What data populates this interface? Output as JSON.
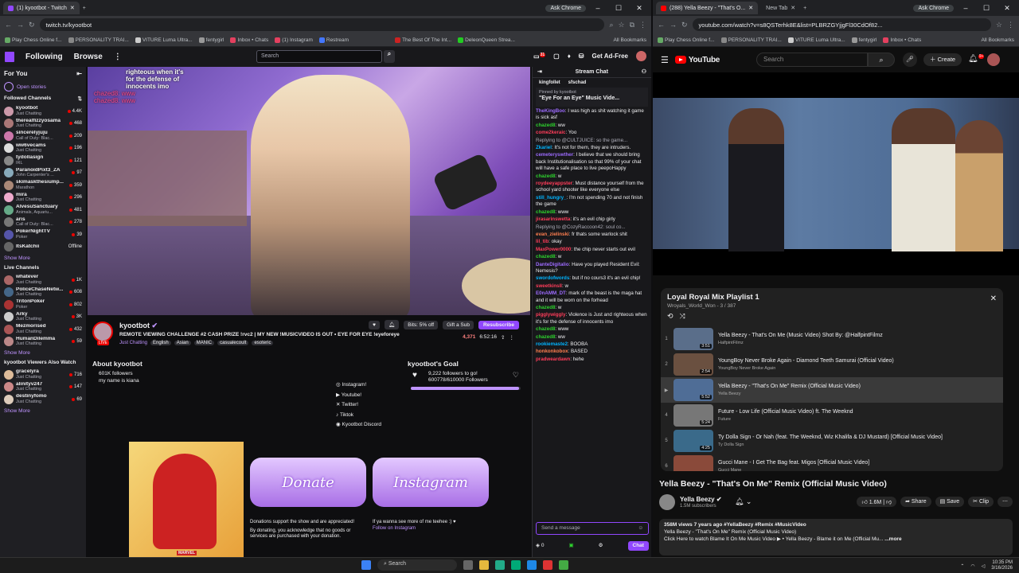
{
  "twitch_browser": {
    "tabs": [
      {
        "label": "(1) kyootbot - Twitch",
        "active": true
      },
      {
        "label": "New Tab",
        "active": false
      }
    ],
    "ask_chrome": "Ask Chrome",
    "url": "twitch.tv/kyootbot",
    "bookmarks": [
      "Play Chess Online f...",
      "PERSONALITY TRAI...",
      "VITURE Luma Ultra...",
      "fentygirl",
      "Inbox • Chats",
      "(1) Instagram",
      "Restream",
      "The Best Of The Int...",
      "DeleonQueen Strea...",
      "All Bookmarks"
    ]
  },
  "twitch": {
    "nav": {
      "following": "Following",
      "browse": "Browse",
      "search_placeholder": "Search",
      "ad_free": "Get Ad-Free",
      "notif_count": "31"
    },
    "sidebar": {
      "for_you": "For You",
      "open_stories": "Open stories",
      "followed_title": "Followed Channels",
      "followed": [
        {
          "name": "kyootbot",
          "game": "Just Chatting",
          "viewers": "4.4K",
          "color": "#c9a"
        },
        {
          "name": "therealfizzyosama",
          "game": "Just Chatting",
          "viewers": "468",
          "color": "#a77"
        },
        {
          "name": "sincerelyjuju",
          "game": "Call of Duty: Blac...",
          "viewers": "209",
          "color": "#c7a"
        },
        {
          "name": "ww6vecams",
          "game": "Just Chatting",
          "viewers": "196",
          "color": "#ddd"
        },
        {
          "name": "tydollasign",
          "game": "IRL",
          "viewers": "121",
          "color": "#888"
        },
        {
          "name": "ParanoidPixt3_ZA",
          "game": "John Carpenter's ...",
          "viewers": "97",
          "color": "#8ab"
        },
        {
          "name": "skimaskthesiump...",
          "game": "Marathon",
          "viewers": "359",
          "color": "#a87"
        },
        {
          "name": "mira",
          "game": "Just Chatting",
          "viewers": "296",
          "color": "#eac"
        },
        {
          "name": "AlvesuSanctuary",
          "game": "Animals, Aquariu...",
          "viewers": "481",
          "color": "#6a8"
        },
        {
          "name": "aris",
          "game": "Call of Duty: Blac...",
          "viewers": "278",
          "color": "#777"
        },
        {
          "name": "PokerNightTV",
          "game": "Poker",
          "viewers": "39",
          "color": "#55a"
        },
        {
          "name": "ItsKatchii",
          "game": "",
          "viewers": "Offline",
          "color": "#666"
        }
      ],
      "show_more": "Show More",
      "live_title": "Live Channels",
      "live": [
        {
          "name": "whatever",
          "game": "Just Chatting",
          "viewers": "1K",
          "color": "#a66"
        },
        {
          "name": "PoliceChaseNetw...",
          "game": "Just Chatting",
          "viewers": "608",
          "color": "#468"
        },
        {
          "name": "TritonPoker",
          "game": "Poker",
          "viewers": "802",
          "color": "#a33"
        },
        {
          "name": "Arky",
          "game": "Just Chatting",
          "viewers": "3K",
          "color": "#ccc"
        },
        {
          "name": "Mezmorised",
          "game": "Just Chatting",
          "viewers": "432",
          "color": "#a55"
        },
        {
          "name": "HumanDilemma",
          "game": "Just Chatting",
          "viewers": "59",
          "color": "#b88"
        }
      ],
      "also_title": "kyootbot Viewers Also Watch",
      "also": [
        {
          "name": "gracelyra",
          "game": "Just Chatting",
          "viewers": "716",
          "color": "#db9"
        },
        {
          "name": "alinityv247",
          "game": "Just Chatting",
          "viewers": "147",
          "color": "#c88"
        },
        {
          "name": "destinyfomo",
          "game": "Just Chatting",
          "viewers": "69",
          "color": "#dcb"
        }
      ]
    },
    "overlay_chat": [
      "righteous when it's",
      "for the defense of",
      "innocents imo",
      "chazed8: www",
      "chazed8: www"
    ],
    "stream": {
      "name": "kyootbot",
      "title": "REMOTE VIEWING CHALLENGE #2 CASH PRIZE !rvc2 | MY NEW !MUSICVIDEO IS OUT • EYE FOR EYE !eyeforeye",
      "category": "Just Chatting",
      "tags": [
        "English",
        "Asian",
        "MANIC",
        "casualecoult",
        "esoteric"
      ],
      "bits": "Bits: 5% off",
      "gift_sub": "Gift a Sub",
      "resubscribe": "Resubscribe",
      "viewers": "4,371",
      "uptime": "6:52:16",
      "live": "LIVE"
    },
    "about": {
      "title": "About kyootbot",
      "followers": "601K followers",
      "bio": "my name is kiana",
      "socials": [
        "Instagram!",
        "Youtube!",
        "Twitter!",
        "Tiktok",
        "Kyootbot Discord"
      ]
    },
    "goal": {
      "title": "kyootbot's Goal",
      "line1": "9,222 followers to go!",
      "line2": "600778/610000 Followers",
      "progress": 0.985
    },
    "panels": {
      "donate": "Donate",
      "instagram": "Instagram",
      "donate_text": "Donations support the show and are appreciated!",
      "donate_note": "By donating, you acknowledge that no goods or services are purchased with your donation.",
      "insta_text": "If ya wanna see more of me teehee :) ♥",
      "insta_link": "Follow on Instagram",
      "marvel": "MARVEL"
    },
    "chat": {
      "header": "Stream Chat",
      "gifters": [
        "kingfollet",
        "sfschad"
      ],
      "pinned_by": "Pinned by kyootbot",
      "pinned": "\"Eye For an Eye\" Music Vide...",
      "messages": [
        {
          "user": "TheKingBoo",
          "text": "I was high as shit watching it game is sick asf",
          "c": "u3"
        },
        {
          "user": "chazed8",
          "text": "ww",
          "c": "u1"
        },
        {
          "user": "come2keraic",
          "text": "Yoo",
          "c": "u2"
        },
        {
          "user": "",
          "text": "Replying to @CULTJUICE: so the game...",
          "c": ""
        },
        {
          "user": "Zkariel",
          "text": "It's not for them, they are intruders.",
          "c": "u4"
        },
        {
          "user": "cemeteryswther",
          "text": "I believe that we should bring back Institutionalisation so that 99% of your chat will have a safe place to live peepoHappy",
          "c": "u3"
        },
        {
          "user": "chazed8",
          "text": "w",
          "c": "u1"
        },
        {
          "user": "roydeeyappster",
          "text": "Must distance yourself from the school yard shooter like everyone else",
          "c": "u2"
        },
        {
          "user": "still_hungry_",
          "text": "I'm not spending 70 and not finish the game",
          "c": "u4"
        },
        {
          "user": "chazed8",
          "text": "www",
          "c": "u1"
        },
        {
          "user": "jirasarinswetta",
          "text": "it's an evil chip girly",
          "c": "u2"
        },
        {
          "user": "",
          "text": "Replying to @CozyRaccoon42: soul co...",
          "c": ""
        },
        {
          "user": "evan_zielinski",
          "text": "fr thats some warlock shit",
          "c": "u5"
        },
        {
          "user": "lil_tib",
          "text": "okay",
          "c": "u2"
        },
        {
          "user": "MaxPower0000",
          "text": "the chip never starts out evil",
          "c": "u2"
        },
        {
          "user": "chazed8",
          "text": "w",
          "c": "u1"
        },
        {
          "user": "DanteDigitalio",
          "text": "Have you played Resident Evil: Nemesis?",
          "c": "u3"
        },
        {
          "user": "swordofwords",
          "text": "but if no cours3 it's an evil chip!",
          "c": "u4"
        },
        {
          "user": "sweetkinsll",
          "text": "w",
          "c": "u2"
        },
        {
          "user": "E0nAMM_DT",
          "text": "mark of the beast is the maga hat and it will be worn on the forhead",
          "c": "u3"
        },
        {
          "user": "chazed8",
          "text": "w",
          "c": "u1"
        },
        {
          "user": "pigglywiggly",
          "text": "Violence is Just and righteous when it's for the defense of innocents imo",
          "c": "u2"
        },
        {
          "user": "chazed8",
          "text": "www",
          "c": "u1"
        },
        {
          "user": "chazed8",
          "text": "ww",
          "c": "u1"
        },
        {
          "user": "rookiemaste2",
          "text": "BOOBA",
          "c": "u4"
        },
        {
          "user": "honkonkobox",
          "text": "BASED",
          "c": "u5"
        },
        {
          "user": "pradweardawn",
          "text": "hehe",
          "c": "u2"
        }
      ],
      "input_placeholder": "Send a message",
      "points": "0",
      "chat_button": "Chat"
    }
  },
  "yt_browser": {
    "tabs": [
      {
        "label": "(288) Yella Beezy - \"That's O...",
        "active": true
      },
      {
        "label": "New Tab",
        "active": false
      }
    ],
    "ask_chrome": "Ask Chrome",
    "url": "youtube.com/watch?v=s8QSTerhk8E&list=PLBRZGYjjgFl30CdOf82...",
    "bookmarks": [
      "Play Chess Online f...",
      "PERSONALITY TRAI...",
      "VITURE Luma Ultra...",
      "fentygirl",
      "Inbox • Chats",
      "All Bookmarks"
    ]
  },
  "youtube": {
    "logo": "YouTube",
    "search_placeholder": "Search",
    "create": "Create",
    "notif": "9+",
    "playlist": {
      "title": "Loyal Royal Mix Playlist 1",
      "owner": "Wroyals_World_Won",
      "position": "3 / 387",
      "items": [
        {
          "idx": "1",
          "title": "Yella Beezy - That's On Me (Music Video) Shot By: @HalfpintFilmz",
          "channel": "HalfpintFilmz",
          "dur": "3:51",
          "color": "#5a6e8a"
        },
        {
          "idx": "2",
          "title": "YoungBoy Never Broke Again - Diamond Teeth Samurai (Official Video)",
          "channel": "YoungBoy Never Broke Again",
          "dur": "2:54",
          "color": "#6a5040"
        },
        {
          "idx": "▶",
          "title": "Yella Beezy - \"That's On Me\" Remix (Official Music Video)",
          "channel": "Yella Beezy",
          "dur": "5:52",
          "color": "#4f6d96"
        },
        {
          "idx": "4",
          "title": "Future - Low Life (Official Music Video) ft. The Weeknd",
          "channel": "Future",
          "dur": "5:24",
          "color": "#777"
        },
        {
          "idx": "5",
          "title": "Ty Dolla Sign - Or Nah (feat. The Weeknd, Wiz Khalifa & DJ Mustard) [Official Music Video]",
          "channel": "Ty Dolla Sign",
          "dur": "4:25",
          "color": "#3a6a8a"
        },
        {
          "idx": "6",
          "title": "Gucci Mane - I Get The Bag feat. Migos [Official Music Video]",
          "channel": "Gucci Mane",
          "dur": "",
          "color": "#8a4a3a"
        }
      ]
    },
    "video_title": "Yella Beezy - \"That's On Me\" Remix (Official Music Video)",
    "channel": "Yella Beezy",
    "subs": "1.5M subscribers",
    "likes": "1.6M",
    "actions": [
      "Share",
      "Save",
      "Clip"
    ],
    "meta": "358M views  7 years ago  #YellaBeezy #Remix #MusicVideo",
    "desc_line1": "Yella Beezy - \"That's On Me\" Remix (Official Music Video)",
    "desc_line2": "Click Here to watch Blame It On Me Music Video ▶ • Yella Beezy - Blame it on Me (Official Mu...",
    "more": "...more"
  },
  "taskbar": {
    "search": "Search",
    "time": "10:35 PM",
    "date": "3/16/2026"
  }
}
